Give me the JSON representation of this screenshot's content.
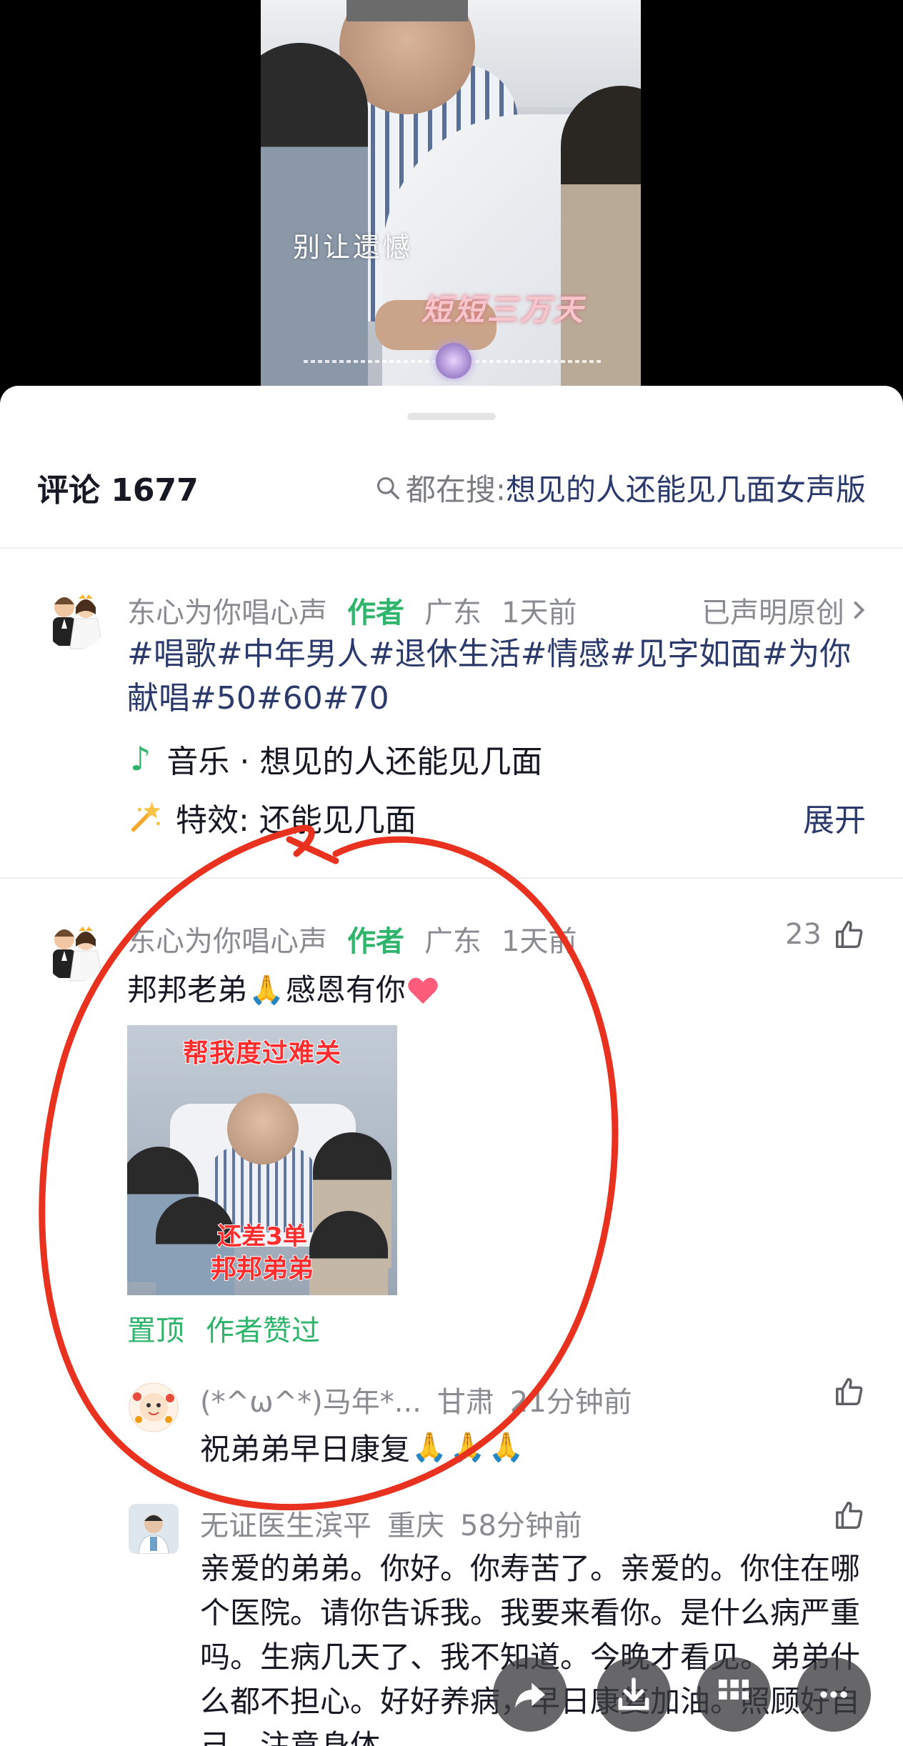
{
  "video": {
    "caption_line1": "别让遗憾",
    "caption_line2": "短短三万天"
  },
  "header": {
    "comment_label": "评论 1677",
    "search_prefix": "都在搜:",
    "search_query": "想见的人还能见几面女声版"
  },
  "description": {
    "username": "东心为你唱心声",
    "author_tag": "作者",
    "location": "广东",
    "time": "1天前",
    "claimed_label": "已声明原创",
    "tags": "#唱歌#中年男人#退休生活#情感#见字如面#为你献唱#50#60#70",
    "music_label": "音乐 · 想见的人还能见几面",
    "effect_label": "特效: 还能见几面",
    "expand_label": "展开"
  },
  "comment": {
    "username": "东心为你唱心声",
    "author_tag": "作者",
    "location": "广东",
    "time": "1天前",
    "likes": "23",
    "text_before": "邦邦老弟",
    "text_after": "感恩有你",
    "image_title": "帮我度过难关",
    "image_line1": "还差3单",
    "image_line2": "邦邦弟弟",
    "pinned_label": "置顶",
    "author_liked_label": "作者赞过"
  },
  "replies": [
    {
      "username": "(*^ω^*)马年*...",
      "location": "甘肃",
      "time": "21分钟前",
      "text": "祝弟弟早日康复"
    },
    {
      "username": "无证医生滨平",
      "location": "重庆",
      "time": "58分钟前",
      "text": "亲爱的弟弟。你好。你寿苦了。亲爱的。你住在哪个医院。请你告诉我。我要来看你。是什么病严重吗。生病几天了、我不知道。今晚才看见。弟弟什么都不担心。好好养病，早日康复加油。照顾好自己。注意身体。"
    }
  ],
  "icons": {
    "search": "search-icon",
    "like": "thumbs-up-icon",
    "music": "music-note-icon",
    "effect": "magic-wand-icon",
    "share": "share-icon",
    "download": "download-icon",
    "grid": "grid-icon",
    "more": "more-icon"
  },
  "colors": {
    "accent_green": "#2fb56b",
    "link_blue": "#2b3a6b",
    "muted_gray": "#8a8b91",
    "annotation_red": "#e8321f"
  }
}
